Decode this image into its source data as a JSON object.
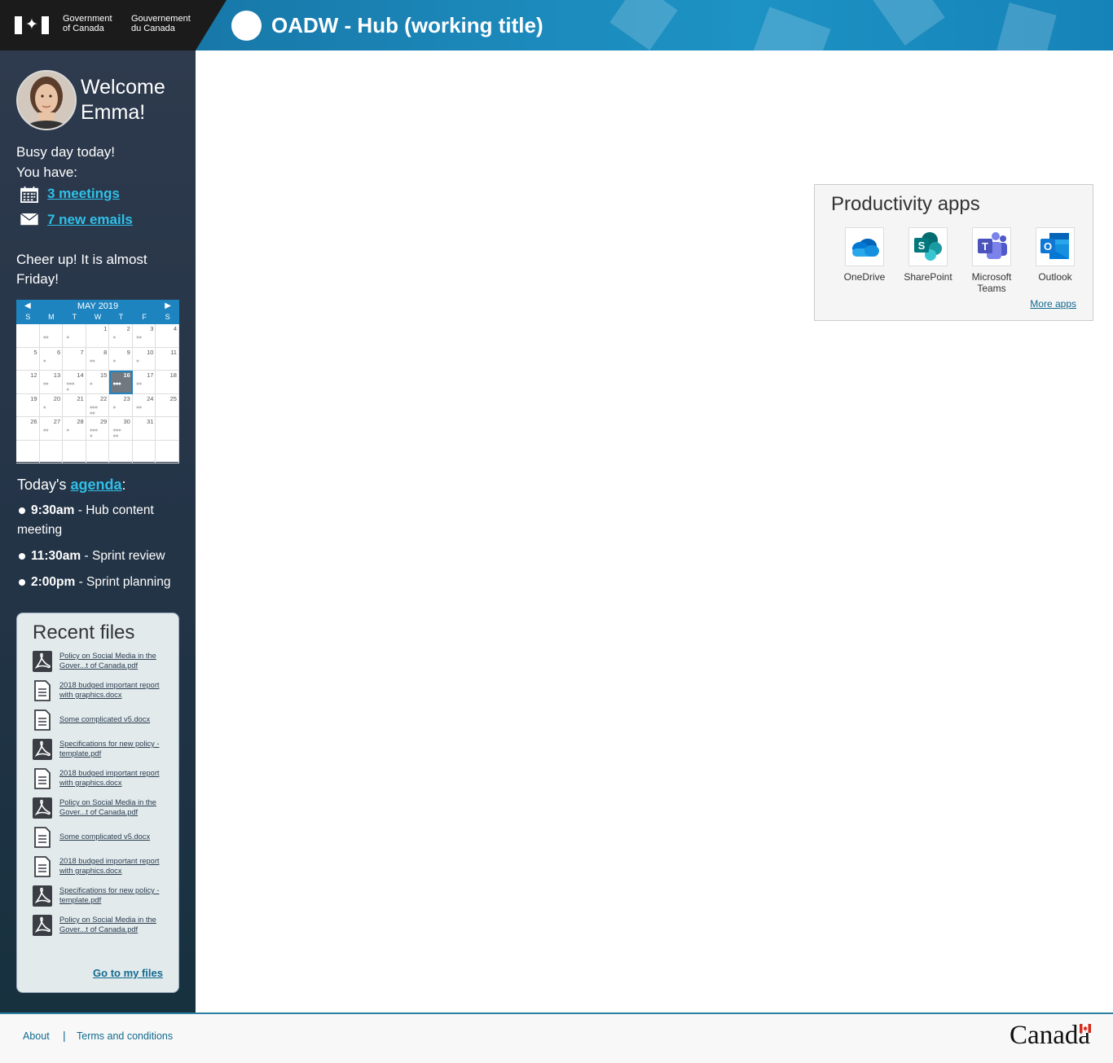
{
  "header": {
    "gov_en": [
      "Government",
      "of Canada"
    ],
    "gov_fr": [
      "Gouvernement",
      "du Canada"
    ],
    "app_title": "OADW - Hub (working title)"
  },
  "sidebar": {
    "welcome": [
      "Welcome",
      "Emma!"
    ],
    "busy": [
      "Busy day today!",
      "You have:"
    ],
    "meetings_link": "3 meetings",
    "emails_link": "7 new emails",
    "cheer": "Cheer up! It is almost Friday!"
  },
  "calendar": {
    "title": "MAY 2019",
    "prev_icon": "triangle-left-icon",
    "next_icon": "triangle-right-icon",
    "days_of_week": [
      "S",
      "M",
      "T",
      "W",
      "T",
      "F",
      "S"
    ],
    "today": 16,
    "weeks": [
      [
        {
          "d": "",
          "e": 0
        },
        {
          "d": "",
          "e": 2
        },
        {
          "d": "",
          "e": 1
        },
        {
          "d": "1",
          "e": 0
        },
        {
          "d": "2",
          "e": 1
        },
        {
          "d": "3",
          "e": 2
        },
        {
          "d": "4",
          "e": 0
        }
      ],
      [
        {
          "d": "5",
          "e": 0
        },
        {
          "d": "6",
          "e": 1
        },
        {
          "d": "7",
          "e": 0
        },
        {
          "d": "8",
          "e": 2
        },
        {
          "d": "9",
          "e": 1
        },
        {
          "d": "10",
          "e": 1
        },
        {
          "d": "11",
          "e": 0
        }
      ],
      [
        {
          "d": "12",
          "e": 0
        },
        {
          "d": "13",
          "e": 2
        },
        {
          "d": "14",
          "e": 4
        },
        {
          "d": "15",
          "e": 1
        },
        {
          "d": "16",
          "e": 3
        },
        {
          "d": "17",
          "e": 2
        },
        {
          "d": "18",
          "e": 0
        }
      ],
      [
        {
          "d": "19",
          "e": 0
        },
        {
          "d": "20",
          "e": 1
        },
        {
          "d": "21",
          "e": 0
        },
        {
          "d": "22",
          "e": 5
        },
        {
          "d": "23",
          "e": 1
        },
        {
          "d": "24",
          "e": 2
        },
        {
          "d": "25",
          "e": 0
        }
      ],
      [
        {
          "d": "26",
          "e": 0
        },
        {
          "d": "27",
          "e": 2
        },
        {
          "d": "28",
          "e": 1
        },
        {
          "d": "29",
          "e": 4
        },
        {
          "d": "30",
          "e": 5
        },
        {
          "d": "31",
          "e": 0
        },
        {
          "d": "",
          "e": 0
        }
      ],
      [
        {
          "d": "",
          "e": 0
        },
        {
          "d": "",
          "e": 0
        },
        {
          "d": "",
          "e": 0
        },
        {
          "d": "",
          "e": 0
        },
        {
          "d": "",
          "e": 0
        },
        {
          "d": "",
          "e": 0
        },
        {
          "d": "",
          "e": 0
        }
      ]
    ]
  },
  "agenda": {
    "prefix": "Today's ",
    "link": "agenda",
    "suffix": ":",
    "items": [
      {
        "time": "9:30am",
        "text": " - Hub content meeting"
      },
      {
        "time": "11:30am",
        "text": " - Sprint review"
      },
      {
        "time": "2:00pm",
        "text": " - Sprint planning"
      }
    ]
  },
  "recent_files": {
    "title": "Recent files",
    "files": [
      {
        "name": "Policy on Social Media in the Gover...t of Canada.pdf",
        "type": "pdf"
      },
      {
        "name": "2018 budged important report with graphics.docx",
        "type": "doc"
      },
      {
        "name": "Some complicated v5.docx",
        "type": "doc"
      },
      {
        "name": "Specifications for new policy - template.pdf",
        "type": "pdf"
      },
      {
        "name": "2018 budged important report with graphics.docx",
        "type": "doc"
      },
      {
        "name": "Policy on Social Media in the Gover...t of Canada.pdf",
        "type": "pdf"
      },
      {
        "name": "Some complicated v5.docx",
        "type": "doc"
      },
      {
        "name": "2018 budged important report with graphics.docx",
        "type": "doc"
      },
      {
        "name": "Specifications for new policy - template.pdf",
        "type": "pdf"
      },
      {
        "name": "Policy on Social Media in the Gover...t of Canada.pdf",
        "type": "pdf"
      }
    ],
    "go_link": "Go to my files"
  },
  "productivity": {
    "title": "Productivity apps",
    "apps": [
      {
        "name": "OneDrive",
        "icon": "onedrive-icon"
      },
      {
        "name": "SharePoint",
        "icon": "sharepoint-icon"
      },
      {
        "name": "Microsoft Teams",
        "icon": "teams-icon"
      },
      {
        "name": "Outlook",
        "icon": "outlook-icon"
      }
    ],
    "more_link": "More apps"
  },
  "footer": {
    "about": "About",
    "separator": "|",
    "terms": "Terms and conditions",
    "wordmark": "Canada"
  },
  "colors": {
    "banner": "#1c89bb",
    "sidebar": "#243447",
    "link_light": "#2fc0e9",
    "link_dark": "#116a8f"
  }
}
